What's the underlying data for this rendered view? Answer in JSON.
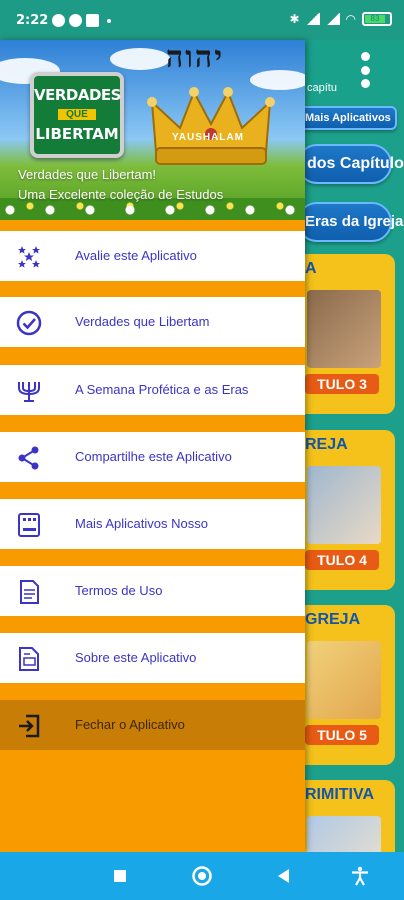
{
  "status_bar": {
    "time": "2:22",
    "battery": "83"
  },
  "background_app": {
    "title": "capítu",
    "buttons": [
      "Mais Aplicativos",
      "dos Capítulos",
      "Eras da Igreja"
    ],
    "cards": [
      {
        "heading": "A",
        "chip": "TULO 3"
      },
      {
        "heading": "REJA",
        "chip": "TULO 4"
      },
      {
        "heading": "GREJA",
        "chip": "TULO 5"
      },
      {
        "heading": "RIMITIVA",
        "chip": ""
      }
    ]
  },
  "drawer": {
    "header": {
      "logo_line1": "VERDADES",
      "logo_line2": "QUE",
      "logo_line3": "LIBERTAM",
      "hebrew_title": "יהוה",
      "crown_label": "YAUSHALAM",
      "title": "Verdades que Libertam!",
      "subtitle": "Uma Excelente coleção de Estudos"
    },
    "items": [
      {
        "label": "Avalie este Aplicativo",
        "icon": "stars-icon"
      },
      {
        "label": "Verdades que Libertam",
        "icon": "check-circle-icon"
      },
      {
        "label": "A Semana Profética e as Eras",
        "icon": "menorah-icon"
      },
      {
        "label": "Compartilhe este Aplicativo",
        "icon": "share-icon"
      },
      {
        "label": "Mais Aplicativos Nosso",
        "icon": "apps-icon"
      },
      {
        "label": "Termos de Uso",
        "icon": "document-icon"
      },
      {
        "label": "Sobre este Aplicativo",
        "icon": "info-document-icon"
      },
      {
        "label": "Fechar o Aplicativo",
        "icon": "exit-icon"
      }
    ]
  },
  "colors": {
    "drawer_background": "#f79b00",
    "menu_text": "#3b34c7",
    "status_bar": "#1e9b86",
    "nav_bar": "#1aa7e8",
    "selected_item": "#c87e06"
  }
}
